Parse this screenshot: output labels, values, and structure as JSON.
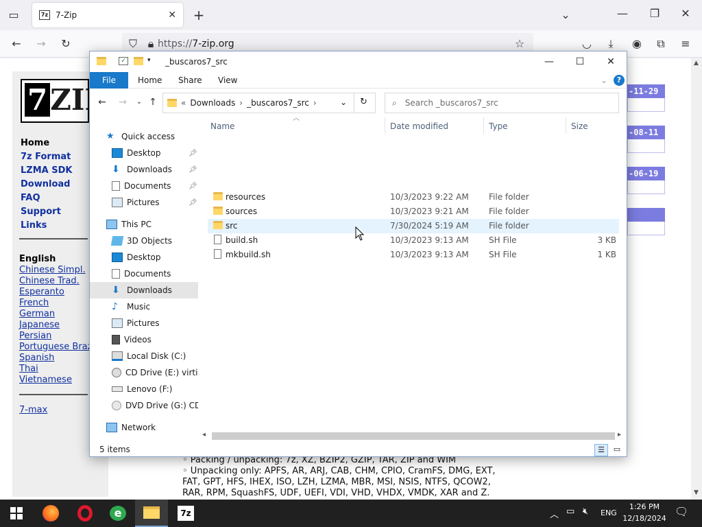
{
  "browser": {
    "tab_title": "7-Zip",
    "tab_favicon": "7z",
    "new_tab_label": "+",
    "url_scheme": "https://",
    "url_host": "7-zip.org",
    "icons": [
      "tab-list-icon",
      "close-icon",
      "new-tab-icon",
      "chevron-down-icon",
      "minimize-icon",
      "restore-icon",
      "back-icon",
      "forward-icon",
      "reload-icon",
      "shield-icon",
      "lock-icon",
      "bookmark-star-icon",
      "pocket-icon",
      "download-icon",
      "account-icon",
      "extensions-icon",
      "menu-icon"
    ]
  },
  "webpage": {
    "logo_text": "ZIP",
    "logo_seven": "7",
    "nav": [
      "Home",
      "7z Format",
      "LZMA SDK",
      "Download",
      "FAQ",
      "Support",
      "Links"
    ],
    "languages_heading": "English",
    "languages": [
      "Chinese Simpl.",
      "Chinese Trad.",
      "Esperanto",
      "French",
      "German",
      "Japanese",
      "Persian",
      "Portuguese Brazil",
      "Spanish",
      "Thai",
      "Vietnamese"
    ],
    "extra_link": "7-max",
    "date_tags": [
      "-11-29",
      "-08-11",
      "-06-19"
    ],
    "body_lines": [
      "◦ Packing / unpacking: 7z, XZ, BZIP2, GZIP, TAR, ZIP and WIM",
      "◦ Unpacking only: APFS, AR, ARJ, CAB, CHM, CPIO, CramFS, DMG, EXT,",
      "FAT, GPT, HFS, IHEX, ISO, LZH, LZMA, MBR, MSI, NSIS, NTFS, QCOW2,",
      "RAR, RPM, SquashFS, UDF, UEFI, VDI, VHD, VHDX, VMDK, XAR and Z."
    ]
  },
  "explorer": {
    "title": "_buscaros7_src",
    "ribbon_tabs": {
      "file": "File",
      "home": "Home",
      "share": "Share",
      "view": "View"
    },
    "help": "?",
    "address": {
      "overflow": "«",
      "crumbs": [
        "Downloads",
        "_buscaros7_src"
      ]
    },
    "search_placeholder": "Search _buscaros7_src",
    "nav_pane": {
      "quick_access": "Quick access",
      "qa_items": [
        "Desktop",
        "Downloads",
        "Documents",
        "Pictures"
      ],
      "this_pc": "This PC",
      "pc_items": [
        "3D Objects",
        "Desktop",
        "Documents",
        "Downloads",
        "Music",
        "Pictures",
        "Videos",
        "Local Disk (C:)",
        "CD Drive (E:) virtio-win",
        "Lenovo (F:)",
        "DVD Drive (G:) CDROM"
      ],
      "network": "Network"
    },
    "columns": {
      "name": "Name",
      "date": "Date modified",
      "type": "Type",
      "size": "Size"
    },
    "files": [
      {
        "name": "resources",
        "date": "10/3/2023 9:22 AM",
        "type": "File folder",
        "size": "",
        "kind": "folder"
      },
      {
        "name": "sources",
        "date": "10/3/2023 9:21 AM",
        "type": "File folder",
        "size": "",
        "kind": "folder"
      },
      {
        "name": "src",
        "date": "7/30/2024 5:19 AM",
        "type": "File folder",
        "size": "",
        "kind": "folder"
      },
      {
        "name": "build.sh",
        "date": "10/3/2023 9:13 AM",
        "type": "SH File",
        "size": "3 KB",
        "kind": "file"
      },
      {
        "name": "mkbuild.sh",
        "date": "10/3/2023 9:13 AM",
        "type": "SH File",
        "size": "1 KB",
        "kind": "file"
      }
    ],
    "status": "5 items"
  },
  "taskbar": {
    "lang": "ENG",
    "time": "1:26 PM",
    "date": "12/18/2024",
    "apps": [
      "start-icon",
      "firefox-icon",
      "opera-icon",
      "ie-icon",
      "file-explorer-icon",
      "7zip-icon"
    ]
  }
}
